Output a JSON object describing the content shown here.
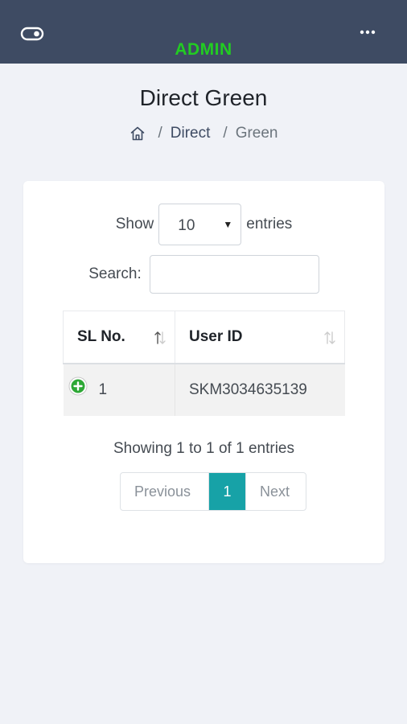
{
  "header": {
    "brand": "ADMIN",
    "brand_color": "#22cc22",
    "bar_color": "#3e4b63",
    "left_icon": "toggle-icon",
    "right_icon": "more-horizontal-icon"
  },
  "page": {
    "title": "Direct Green"
  },
  "breadcrumb": {
    "home_icon": "home-icon",
    "separator": "/",
    "items": [
      "Direct",
      "Green"
    ]
  },
  "length_control": {
    "prefix": "Show",
    "value": "10",
    "suffix": "entries"
  },
  "search": {
    "label": "Search:",
    "value": "",
    "placeholder": ""
  },
  "table": {
    "columns": [
      "SL No.",
      "User ID"
    ],
    "rows": [
      {
        "sl": "1",
        "user_id": "SKM3034635139"
      }
    ]
  },
  "info": "Showing 1 to 1 of 1 entries",
  "pagination": {
    "previous": "Previous",
    "current": "1",
    "next": "Next",
    "active_color": "#17a2a7"
  }
}
